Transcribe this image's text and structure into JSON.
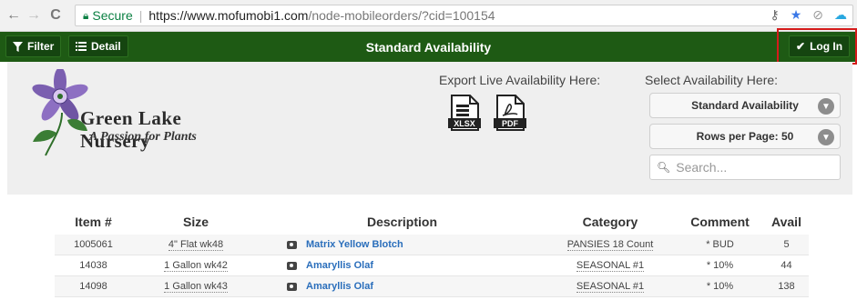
{
  "browser": {
    "back": "←",
    "forward": "→",
    "reload": "C",
    "secure_label": "Secure",
    "url_host": "https://www.mofumobi1.com",
    "url_path": "/node-mobileorders/?cid=100154"
  },
  "appbar": {
    "filter_label": "Filter",
    "detail_label": "Detail",
    "title": "Standard Availability",
    "login_label": "Log In"
  },
  "logo": {
    "name": "Green Lake Nursery",
    "tagline": "A Passion for Plants"
  },
  "export": {
    "label": "Export Live Availability Here:",
    "xlsx": "XLSX",
    "pdf": "PDF"
  },
  "select": {
    "label": "Select Availability Here:",
    "availability_value": "Standard Availability",
    "rows_value": "Rows per Page: 50",
    "search_placeholder": "Search..."
  },
  "table": {
    "headers": [
      "Item #",
      "Size",
      "Description",
      "Category",
      "Comment",
      "Avail"
    ],
    "rows": [
      [
        "1005061",
        "4\" Flat wk48",
        "Matrix Yellow Blotch",
        "PANSIES 18 Count",
        "* BUD",
        "5"
      ],
      [
        "14038",
        "1 Gallon wk42",
        "Amaryllis Olaf",
        "SEASONAL #1",
        "* 10%",
        "44"
      ],
      [
        "14098",
        "1 Gallon wk43",
        "Amaryllis Olaf",
        "SEASONAL #1",
        "* 10%",
        "138"
      ]
    ]
  },
  "colors": {
    "appbar": "#1e5a14",
    "link": "#2a6ebb",
    "highlight": "#d51b1b"
  }
}
